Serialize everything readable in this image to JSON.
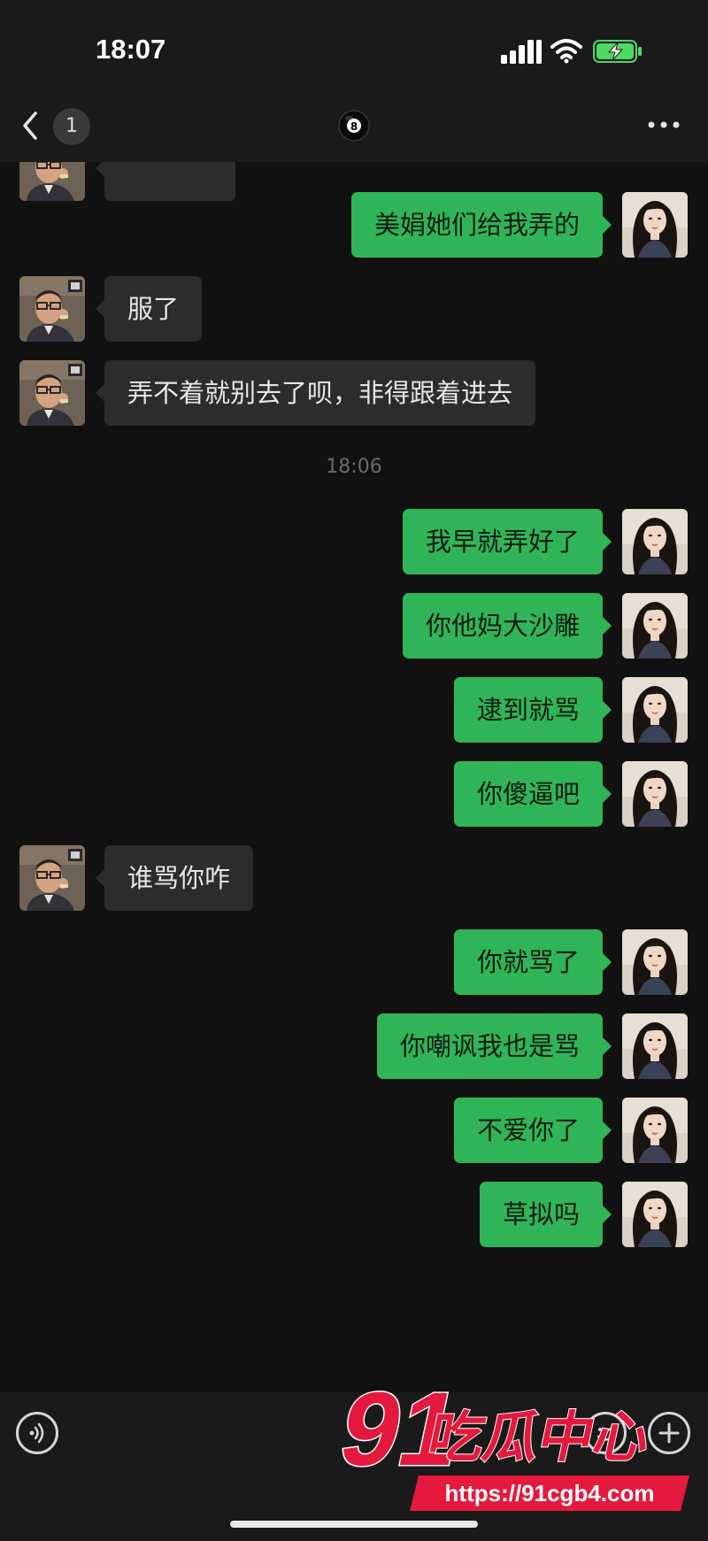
{
  "status_bar": {
    "time": "18:07"
  },
  "nav": {
    "unread_count": "1",
    "title_icon": "8-ball-icon",
    "more_icon": "more-dots-icon"
  },
  "messages": [
    {
      "side": "in",
      "text": "",
      "partial": true
    },
    {
      "side": "out",
      "text": "美娟她们给我弄的"
    },
    {
      "side": "in",
      "text": "服了"
    },
    {
      "side": "in",
      "text": "弄不着就别去了呗，非得跟着进去"
    },
    {
      "type": "time",
      "text": "18:06"
    },
    {
      "side": "out",
      "text": "我早就弄好了"
    },
    {
      "side": "out",
      "text": "你他妈大沙雕"
    },
    {
      "side": "out",
      "text": "逮到就骂"
    },
    {
      "side": "out",
      "text": "你傻逼吧"
    },
    {
      "side": "in",
      "text": "谁骂你咋"
    },
    {
      "side": "out",
      "text": "你就骂了"
    },
    {
      "side": "out",
      "text": "你嘲讽我也是骂"
    },
    {
      "side": "out",
      "text": "不爱你了"
    },
    {
      "side": "out",
      "text": "草拟吗"
    }
  ],
  "input_bar": {
    "voice_icon": "voice-icon",
    "emoji_icon": "emoji-icon",
    "plus_icon": "plus-icon"
  },
  "watermark": {
    "logo_number": "91",
    "logo_text": "吃瓜中心",
    "url": "https://91cgb4.com"
  },
  "colors": {
    "background": "#111111",
    "outgoing_bubble": "#2fb557",
    "incoming_bubble": "#2c2c2c",
    "watermark": "#e5183e"
  }
}
